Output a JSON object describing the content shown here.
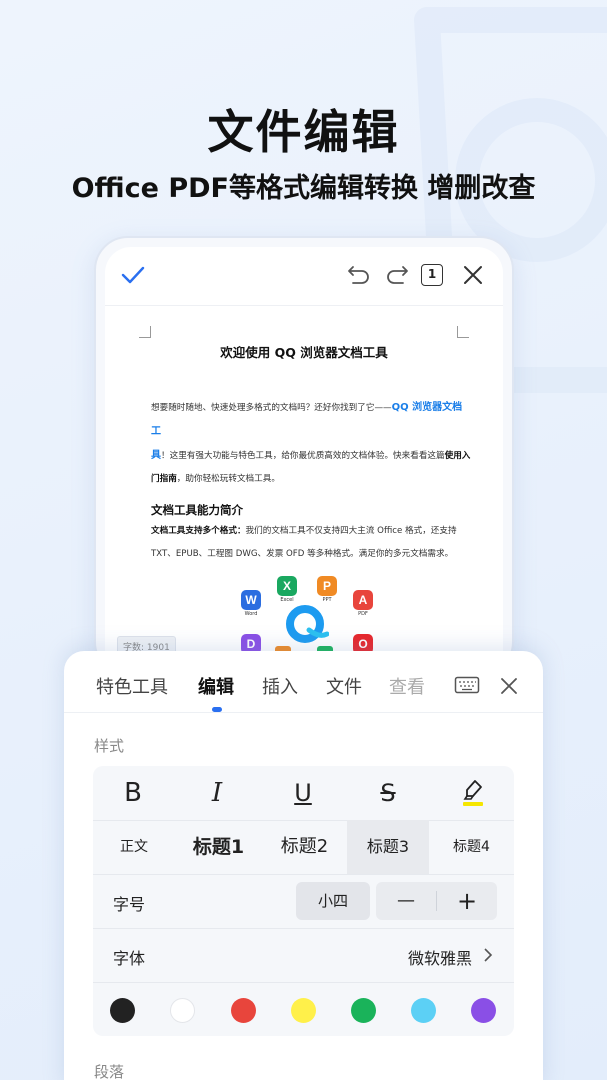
{
  "hero": {
    "title": "文件编辑",
    "subtitle": "Office PDF等格式编辑转换 增删改查"
  },
  "editor_toolbar": {
    "icons": [
      "check-icon",
      "undo-icon",
      "redo-icon",
      "page-count-icon",
      "close-icon"
    ],
    "page_count": "1"
  },
  "document": {
    "title": "欢迎使用 QQ 浏览器文档工具",
    "intro_part1": "想要随时随地、快速处理多格式的文档吗？还好你找到了它——",
    "intro_highlight1": "QQ 浏览器文档工",
    "intro_highlight2": "具",
    "intro_part2": "！这里有强大功能与特色工具，给你最优质高效的文档体验。快来看看这篇",
    "intro_bold1": "使用入",
    "intro_bold2": "门指南",
    "intro_part3": "，助你轻松玩转文档工具。",
    "section_title": "文档工具能力简介",
    "p2_bold": "文档工具支持多个格式：",
    "p2_text1": "我们的文档工具不仅支持四大主流 Office 格式，还支持",
    "p2_text2": "TXT、EPUB、工程图 DWG、发票 OFD 等多种格式。满足你的多元文档需求。",
    "format_icons": [
      {
        "letter": "W",
        "label": "Word",
        "color": "#2b6de0"
      },
      {
        "letter": "X",
        "label": "Excel",
        "color": "#1aa860"
      },
      {
        "letter": "P",
        "label": "PPT",
        "color": "#f08a24"
      },
      {
        "letter": "A",
        "label": "PDF",
        "color": "#e8453c"
      },
      {
        "letter": "D",
        "label": "",
        "color": "#8a4fe6"
      },
      {
        "letter": "O",
        "label": "",
        "color": "#e8262b"
      }
    ],
    "word_count": "字数: 1901"
  },
  "sheet": {
    "tabs": [
      {
        "label": "特色工具",
        "state": "normal"
      },
      {
        "label": "编辑",
        "state": "active"
      },
      {
        "label": "插入",
        "state": "normal"
      },
      {
        "label": "文件",
        "state": "normal"
      },
      {
        "label": "查看",
        "state": "faded"
      }
    ],
    "style_section": "样式",
    "format_buttons": [
      "B",
      "I",
      "U",
      "S"
    ],
    "headings": [
      "正文",
      "标题1",
      "标题2",
      "标题3",
      "标题4"
    ],
    "selected_heading": "标题3",
    "font_size_label": "字号",
    "font_size_value": "小四",
    "minus": "—",
    "plus": "+",
    "font_label": "字体",
    "font_value": "微软雅黑",
    "colors": [
      "#222222",
      "#ffffff",
      "#e8453c",
      "#fff04a",
      "#1ab35a",
      "#5cd0f5",
      "#8a4fe6"
    ],
    "paragraph_section": "段落"
  },
  "colors": {
    "accent": "#2a6ff0",
    "highlight_text": "#1a7ee8",
    "highlighter_underline": "#f5e600"
  }
}
